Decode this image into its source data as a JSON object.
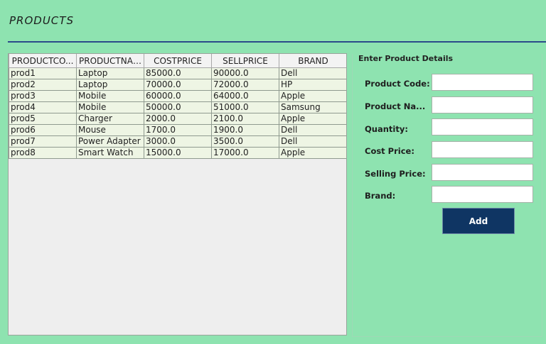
{
  "page": {
    "title": "PRODUCTS"
  },
  "table": {
    "columns": [
      "PRODUCTCO...",
      "PRODUCTNAME",
      "COSTPRICE",
      "SELLPRICE",
      "BRAND"
    ],
    "rows": [
      [
        "prod1",
        "Laptop",
        "85000.0",
        "90000.0",
        "Dell"
      ],
      [
        "prod2",
        "Laptop",
        "70000.0",
        "72000.0",
        "HP"
      ],
      [
        "prod3",
        "Mobile",
        "60000.0",
        "64000.0",
        "Apple"
      ],
      [
        "prod4",
        "Mobile",
        "50000.0",
        "51000.0",
        "Samsung"
      ],
      [
        "prod5",
        "Charger",
        "2000.0",
        "2100.0",
        "Apple"
      ],
      [
        "prod6",
        "Mouse",
        "1700.0",
        "1900.0",
        "Dell"
      ],
      [
        "prod7",
        "Power Adapter",
        "3000.0",
        "3500.0",
        "Dell"
      ],
      [
        "prod8",
        "Smart Watch",
        "15000.0",
        "17000.0",
        "Apple"
      ]
    ]
  },
  "form": {
    "title": "Enter Product Details",
    "fields": [
      {
        "label": "Product Code:",
        "value": ""
      },
      {
        "label": "Product Na...",
        "value": ""
      },
      {
        "label": "Quantity:",
        "value": ""
      },
      {
        "label": "Cost Price:",
        "value": ""
      },
      {
        "label": "Selling Price:",
        "value": ""
      },
      {
        "label": "Brand:",
        "value": ""
      }
    ],
    "add_label": "Add"
  },
  "colors": {
    "background": "#8ee3b0",
    "accent_rule": "#2b4a8a",
    "button": "#0f3563",
    "table_row": "#eef5e4"
  }
}
